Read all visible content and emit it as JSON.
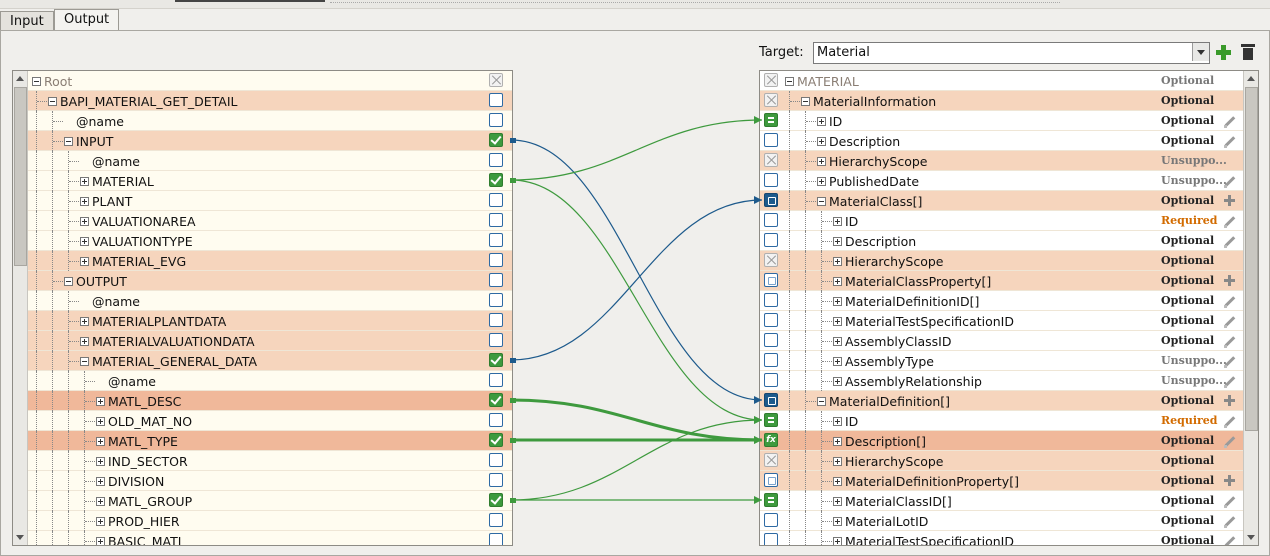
{
  "tabs": [
    {
      "label": "Input",
      "active": false
    },
    {
      "label": "Output",
      "active": true
    }
  ],
  "target": {
    "label": "Target:",
    "value": "Material"
  },
  "colors": {
    "mapped_wire": "#3e9a3e",
    "loop_wire": "#1d5a8c",
    "highlight_row": "#f6d5bd",
    "selected_row": "#f0b89a",
    "required_text": "#d26b00"
  },
  "source_tree": {
    "rows": [
      {
        "label": "Root",
        "depth": 0,
        "expander": "minus",
        "style": "root",
        "check": "disabled"
      },
      {
        "label": "BAPI_MATERIAL_GET_DETAIL",
        "depth": 1,
        "expander": "minus",
        "style": "hl",
        "check": "empty"
      },
      {
        "label": "@name",
        "depth": 2,
        "expander": "none",
        "style": "",
        "check": "empty"
      },
      {
        "label": "INPUT",
        "depth": 2,
        "expander": "minus",
        "style": "hl",
        "check": "checked"
      },
      {
        "label": "@name",
        "depth": 3,
        "expander": "none",
        "style": "",
        "check": "empty"
      },
      {
        "label": "MATERIAL",
        "depth": 3,
        "expander": "plus",
        "style": "",
        "check": "checked"
      },
      {
        "label": "PLANT",
        "depth": 3,
        "expander": "plus",
        "style": "",
        "check": "empty"
      },
      {
        "label": "VALUATIONAREA",
        "depth": 3,
        "expander": "plus",
        "style": "",
        "check": "empty"
      },
      {
        "label": "VALUATIONTYPE",
        "depth": 3,
        "expander": "plus",
        "style": "",
        "check": "empty"
      },
      {
        "label": "MATERIAL_EVG",
        "depth": 3,
        "expander": "plus",
        "style": "hl",
        "check": "empty"
      },
      {
        "label": "OUTPUT",
        "depth": 2,
        "expander": "minus",
        "style": "hl",
        "check": "empty"
      },
      {
        "label": "@name",
        "depth": 3,
        "expander": "none",
        "style": "",
        "check": "empty"
      },
      {
        "label": "MATERIALPLANTDATA",
        "depth": 3,
        "expander": "plus",
        "style": "hl",
        "check": "empty"
      },
      {
        "label": "MATERIALVALUATIONDATA",
        "depth": 3,
        "expander": "plus",
        "style": "hl",
        "check": "empty"
      },
      {
        "label": "MATERIAL_GENERAL_DATA",
        "depth": 3,
        "expander": "minus",
        "style": "hl",
        "check": "checked"
      },
      {
        "label": "@name",
        "depth": 4,
        "expander": "none",
        "style": "",
        "check": "empty"
      },
      {
        "label": "MATL_DESC",
        "depth": 4,
        "expander": "plus",
        "style": "sel",
        "check": "checked"
      },
      {
        "label": "OLD_MAT_NO",
        "depth": 4,
        "expander": "plus",
        "style": "",
        "check": "empty"
      },
      {
        "label": "MATL_TYPE",
        "depth": 4,
        "expander": "plus",
        "style": "sel",
        "check": "checked"
      },
      {
        "label": "IND_SECTOR",
        "depth": 4,
        "expander": "plus",
        "style": "",
        "check": "empty"
      },
      {
        "label": "DIVISION",
        "depth": 4,
        "expander": "plus",
        "style": "",
        "check": "empty"
      },
      {
        "label": "MATL_GROUP",
        "depth": 4,
        "expander": "plus",
        "style": "",
        "check": "checked"
      },
      {
        "label": "PROD_HIER",
        "depth": 4,
        "expander": "plus",
        "style": "",
        "check": "empty"
      },
      {
        "label": "BASIC_MATL",
        "depth": 4,
        "expander": "plus",
        "style": "",
        "check": "empty"
      }
    ]
  },
  "target_tree": {
    "rows": [
      {
        "label": "MATERIAL",
        "depth": 0,
        "expander": "minus",
        "style": "root",
        "check": "disabled",
        "status": "Optional",
        "status_type": "faded",
        "action": "none"
      },
      {
        "label": "MaterialInformation",
        "depth": 1,
        "expander": "minus",
        "style": "hl",
        "check": "disabled",
        "status": "Optional",
        "status_type": "normal",
        "action": "none"
      },
      {
        "label": "ID",
        "depth": 2,
        "expander": "plus",
        "style": "",
        "check": "eq",
        "status": "Optional",
        "status_type": "normal",
        "action": "pencil"
      },
      {
        "label": "Description",
        "depth": 2,
        "expander": "plus",
        "style": "",
        "check": "empty",
        "status": "Optional",
        "status_type": "normal",
        "action": "pencil"
      },
      {
        "label": "HierarchyScope",
        "depth": 2,
        "expander": "plus",
        "style": "hl",
        "check": "disabled",
        "status": "Unsuppo...",
        "status_type": "unsup",
        "action": "none"
      },
      {
        "label": "PublishedDate",
        "depth": 2,
        "expander": "plus",
        "style": "",
        "check": "empty",
        "status": "Unsuppo...",
        "status_type": "unsup",
        "action": "pencil"
      },
      {
        "label": "MaterialClass[]",
        "depth": 2,
        "expander": "minus",
        "style": "hl",
        "check": "loop",
        "status": "Optional",
        "status_type": "normal",
        "action": "plus"
      },
      {
        "label": "ID",
        "depth": 3,
        "expander": "plus",
        "style": "",
        "check": "empty",
        "status": "Required",
        "status_type": "req",
        "action": "pencil"
      },
      {
        "label": "Description",
        "depth": 3,
        "expander": "plus",
        "style": "",
        "check": "empty",
        "status": "Optional",
        "status_type": "normal",
        "action": "pencil"
      },
      {
        "label": "HierarchyScope",
        "depth": 3,
        "expander": "plus",
        "style": "hl",
        "check": "disabled",
        "status": "Optional",
        "status_type": "normal",
        "action": "none"
      },
      {
        "label": "MaterialClassProperty[]",
        "depth": 3,
        "expander": "plus",
        "style": "hl",
        "check": "loop-empty",
        "status": "Optional",
        "status_type": "normal",
        "action": "plus"
      },
      {
        "label": "MaterialDefinitionID[]",
        "depth": 3,
        "expander": "plus",
        "style": "",
        "check": "empty",
        "status": "Optional",
        "status_type": "normal",
        "action": "pencil"
      },
      {
        "label": "MaterialTestSpecificationID",
        "depth": 3,
        "expander": "plus",
        "style": "",
        "check": "empty",
        "status": "Optional",
        "status_type": "normal",
        "action": "pencil"
      },
      {
        "label": "AssemblyClassID",
        "depth": 3,
        "expander": "plus",
        "style": "",
        "check": "empty",
        "status": "Optional",
        "status_type": "normal",
        "action": "pencil"
      },
      {
        "label": "AssemblyType",
        "depth": 3,
        "expander": "plus",
        "style": "",
        "check": "empty",
        "status": "Unsuppo...",
        "status_type": "unsup",
        "action": "pencil"
      },
      {
        "label": "AssemblyRelationship",
        "depth": 3,
        "expander": "plus",
        "style": "",
        "check": "empty",
        "status": "Unsuppo...",
        "status_type": "unsup",
        "action": "pencil"
      },
      {
        "label": "MaterialDefinition[]",
        "depth": 2,
        "expander": "minus",
        "style": "hl",
        "check": "loop",
        "status": "Optional",
        "status_type": "normal",
        "action": "plus"
      },
      {
        "label": "ID",
        "depth": 3,
        "expander": "plus",
        "style": "",
        "check": "eq",
        "status": "Required",
        "status_type": "req",
        "action": "pencil"
      },
      {
        "label": "Description[]",
        "depth": 3,
        "expander": "plus",
        "style": "sel",
        "check": "fx",
        "status": "Optional",
        "status_type": "normal",
        "action": "pencil"
      },
      {
        "label": "HierarchyScope",
        "depth": 3,
        "expander": "plus",
        "style": "hl",
        "check": "disabled",
        "status": "Optional",
        "status_type": "normal",
        "action": "none"
      },
      {
        "label": "MaterialDefinitionProperty[]",
        "depth": 3,
        "expander": "plus",
        "style": "hl",
        "check": "loop-empty",
        "status": "Optional",
        "status_type": "normal",
        "action": "plus"
      },
      {
        "label": "MaterialClassID[]",
        "depth": 3,
        "expander": "plus",
        "style": "",
        "check": "eq",
        "status": "Optional",
        "status_type": "normal",
        "action": "pencil"
      },
      {
        "label": "MaterialLotID",
        "depth": 3,
        "expander": "plus",
        "style": "",
        "check": "empty",
        "status": "Optional",
        "status_type": "normal",
        "action": "pencil"
      },
      {
        "label": "MaterialTestSpecificationID",
        "depth": 3,
        "expander": "plus",
        "style": "",
        "check": "empty",
        "status": "Optional",
        "status_type": "normal",
        "action": "pencil"
      }
    ]
  },
  "mappings": [
    {
      "from": 3,
      "to": 16,
      "kind": "loop"
    },
    {
      "from": 5,
      "to": 2,
      "kind": "mapped"
    },
    {
      "from": 14,
      "to": 6,
      "kind": "loop"
    },
    {
      "from": 16,
      "to": 18,
      "kind": "mapped-bold"
    },
    {
      "from": 18,
      "to": 18,
      "kind": "mapped-bold"
    },
    {
      "from": 21,
      "to": 21,
      "kind": "mapped"
    },
    {
      "from": 21,
      "to": 17,
      "kind": "mapped"
    },
    {
      "from": 5,
      "to": 17,
      "kind": "mapped"
    }
  ],
  "fx_label": "fx"
}
